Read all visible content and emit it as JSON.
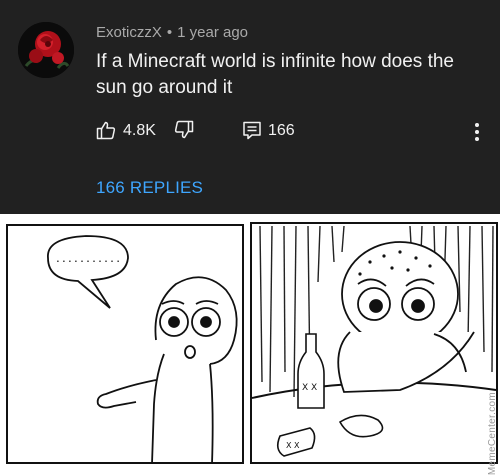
{
  "comment": {
    "username": "ExoticzzX",
    "separator": "•",
    "timestamp": "1 year ago",
    "text": "If a Minecraft world is infinite how does the sun go around it",
    "like_count": "4.8K",
    "reply_count": "166",
    "replies_link": "166 REPLIES",
    "icons": {
      "avatar": "rose-avatar",
      "like": "thumbs-up-icon",
      "dislike": "thumbs-down-icon",
      "reply": "comment-icon",
      "more": "vertical-ellipsis-icon"
    }
  },
  "meme": {
    "watermark": "MemeCenter.com",
    "speech_bubble_text": "..........."
  },
  "colors": {
    "card_background": "#212121",
    "primary_text": "#f1f1f1",
    "secondary_text": "#aaaaaa",
    "link": "#3ea6ff"
  }
}
